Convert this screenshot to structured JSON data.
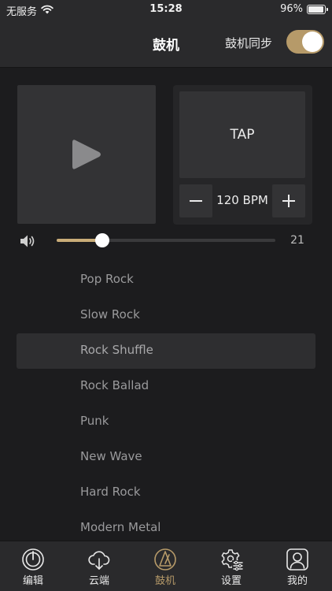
{
  "status_bar": {
    "carrier": "无服务",
    "time": "15:28",
    "battery_percent": "96%",
    "battery_level": 0.96,
    "wifi_icon": "wifi-icon"
  },
  "header": {
    "title": "鼓机",
    "sync_label": "鼓机同步",
    "sync_enabled": true
  },
  "player": {
    "play_icon": "play-icon"
  },
  "tempo": {
    "tap_label": "TAP",
    "bpm_label": "120 BPM",
    "minus_icon": "minus-icon",
    "plus_icon": "plus-icon"
  },
  "volume": {
    "value": "21",
    "level_fraction": 0.21,
    "icon": "speaker-icon"
  },
  "styles": {
    "items": [
      {
        "label": "Pop Rock"
      },
      {
        "label": "Slow Rock"
      },
      {
        "label": "Rock Shuffle"
      },
      {
        "label": "Rock Ballad"
      },
      {
        "label": "Punk"
      },
      {
        "label": "New Wave"
      },
      {
        "label": "Hard Rock"
      },
      {
        "label": "Modern Metal"
      }
    ],
    "selected_index": 2
  },
  "tabs": {
    "items": [
      {
        "label": "编辑",
        "icon": "knob-icon"
      },
      {
        "label": "云端",
        "icon": "cloud-download-icon"
      },
      {
        "label": "鼓机",
        "icon": "metronome-icon"
      },
      {
        "label": "设置",
        "icon": "gear-sliders-icon"
      },
      {
        "label": "我的",
        "icon": "user-icon"
      }
    ],
    "active_index": 2
  },
  "colors": {
    "accent": "#b69a69",
    "background": "#1c1c1e",
    "bar": "#2a2a2c"
  }
}
